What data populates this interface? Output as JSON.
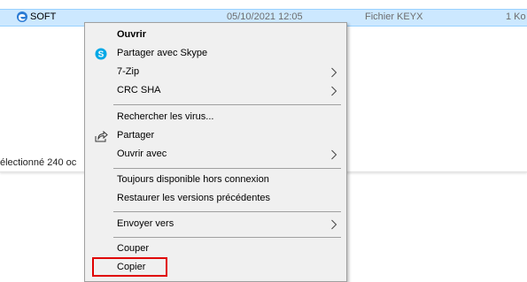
{
  "file": {
    "name": "SOFT",
    "date": "05/10/2021 12:05",
    "type": "Fichier KEYX",
    "size": "1 Ko",
    "icon": "edge-file-icon"
  },
  "status_text": "électionné 240 oc",
  "colors": {
    "selection": "#cce8ff",
    "highlight_box": "#e00000",
    "menu_bg": "#f0f0f0"
  },
  "menu": {
    "items": [
      {
        "label": "Ouvrir",
        "bold": true
      },
      {
        "label": "Partager avec Skype",
        "icon": "skype-icon"
      },
      {
        "label": "7-Zip",
        "submenu": true
      },
      {
        "label": "CRC SHA",
        "submenu": true
      },
      {
        "label": "Rechercher les virus..."
      },
      {
        "label": "Partager",
        "icon": "share-icon"
      },
      {
        "label": "Ouvrir avec",
        "submenu": true
      },
      {
        "label": "Toujours disponible hors connexion"
      },
      {
        "label": "Restaurer les versions précédentes"
      },
      {
        "label": "Envoyer vers",
        "submenu": true
      },
      {
        "label": "Couper"
      },
      {
        "label": "Copier",
        "highlighted": true
      }
    ]
  }
}
